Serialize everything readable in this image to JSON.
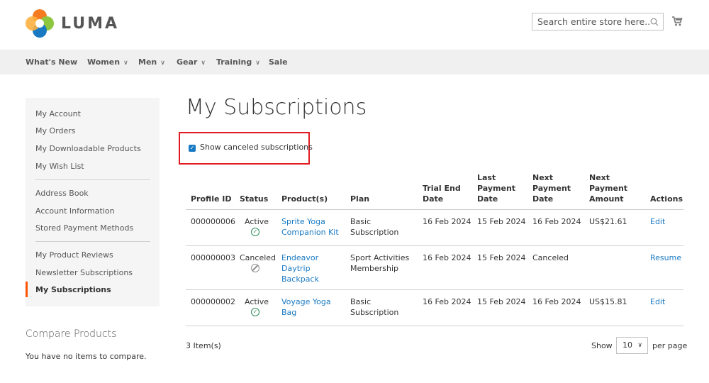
{
  "header": {
    "logo_text": "LUMA",
    "search_placeholder": "Search entire store here...",
    "search_icon": "search-icon",
    "cart_icon": "cart-icon"
  },
  "nav": [
    {
      "label": "What's New",
      "dropdown": false
    },
    {
      "label": "Women",
      "dropdown": true
    },
    {
      "label": "Men",
      "dropdown": true
    },
    {
      "label": "Gear",
      "dropdown": true
    },
    {
      "label": "Training",
      "dropdown": true
    },
    {
      "label": "Sale",
      "dropdown": false
    }
  ],
  "sidebar": {
    "items": [
      "My Account",
      "My Orders",
      "My Downloadable Products",
      "My Wish List",
      "Address Book",
      "Account Information",
      "Stored Payment Methods",
      "My Product Reviews",
      "Newsletter Subscriptions",
      "My Subscriptions"
    ],
    "active": "My Subscriptions"
  },
  "compare": {
    "title": "Compare Products",
    "empty_text": "You have no items to compare."
  },
  "main": {
    "title": "My Subscriptions",
    "show_canceled_label": "Show canceled subscriptions",
    "show_canceled_checked": true,
    "columns": [
      "Profile ID",
      "Status",
      "Product(s)",
      "Plan",
      "Trial End Date",
      "Last Payment Date",
      "Next Payment Date",
      "Next Payment Amount",
      "Actions"
    ],
    "rows": [
      {
        "profile_id": "000000006",
        "status": "Active",
        "product": [
          "Sprite Yoga",
          "Companion Kit"
        ],
        "plan": [
          "Basic",
          "Subscription"
        ],
        "trial_end": "16 Feb 2024",
        "last_payment": "15 Feb 2024",
        "next_payment": "16 Feb 2024",
        "amount": "US$21.61",
        "action": "Edit"
      },
      {
        "profile_id": "000000003",
        "status": "Canceled",
        "product": [
          "Endeavor",
          "Daytrip",
          "Backpack"
        ],
        "plan": [
          "Sport Activities",
          "Membership"
        ],
        "trial_end": "16 Feb 2024",
        "last_payment": "15 Feb 2024",
        "next_payment": "Canceled",
        "amount": "",
        "action": "Resume"
      },
      {
        "profile_id": "000000002",
        "status": "Active",
        "product": [
          "Voyage Yoga",
          "Bag"
        ],
        "plan": [
          "Basic",
          "Subscription"
        ],
        "trial_end": "16 Feb 2024",
        "last_payment": "15 Feb 2024",
        "next_payment": "16 Feb 2024",
        "amount": "US$15.81",
        "action": "Edit"
      }
    ],
    "item_count": "3 Item(s)",
    "show_label": "Show",
    "per_page_value": "10",
    "per_page_label": "per page"
  },
  "colors": {
    "link": "#1979c3",
    "accent": "#ff5501",
    "highlight_border": "#e21b23",
    "active_icon": "#2e8b57"
  }
}
